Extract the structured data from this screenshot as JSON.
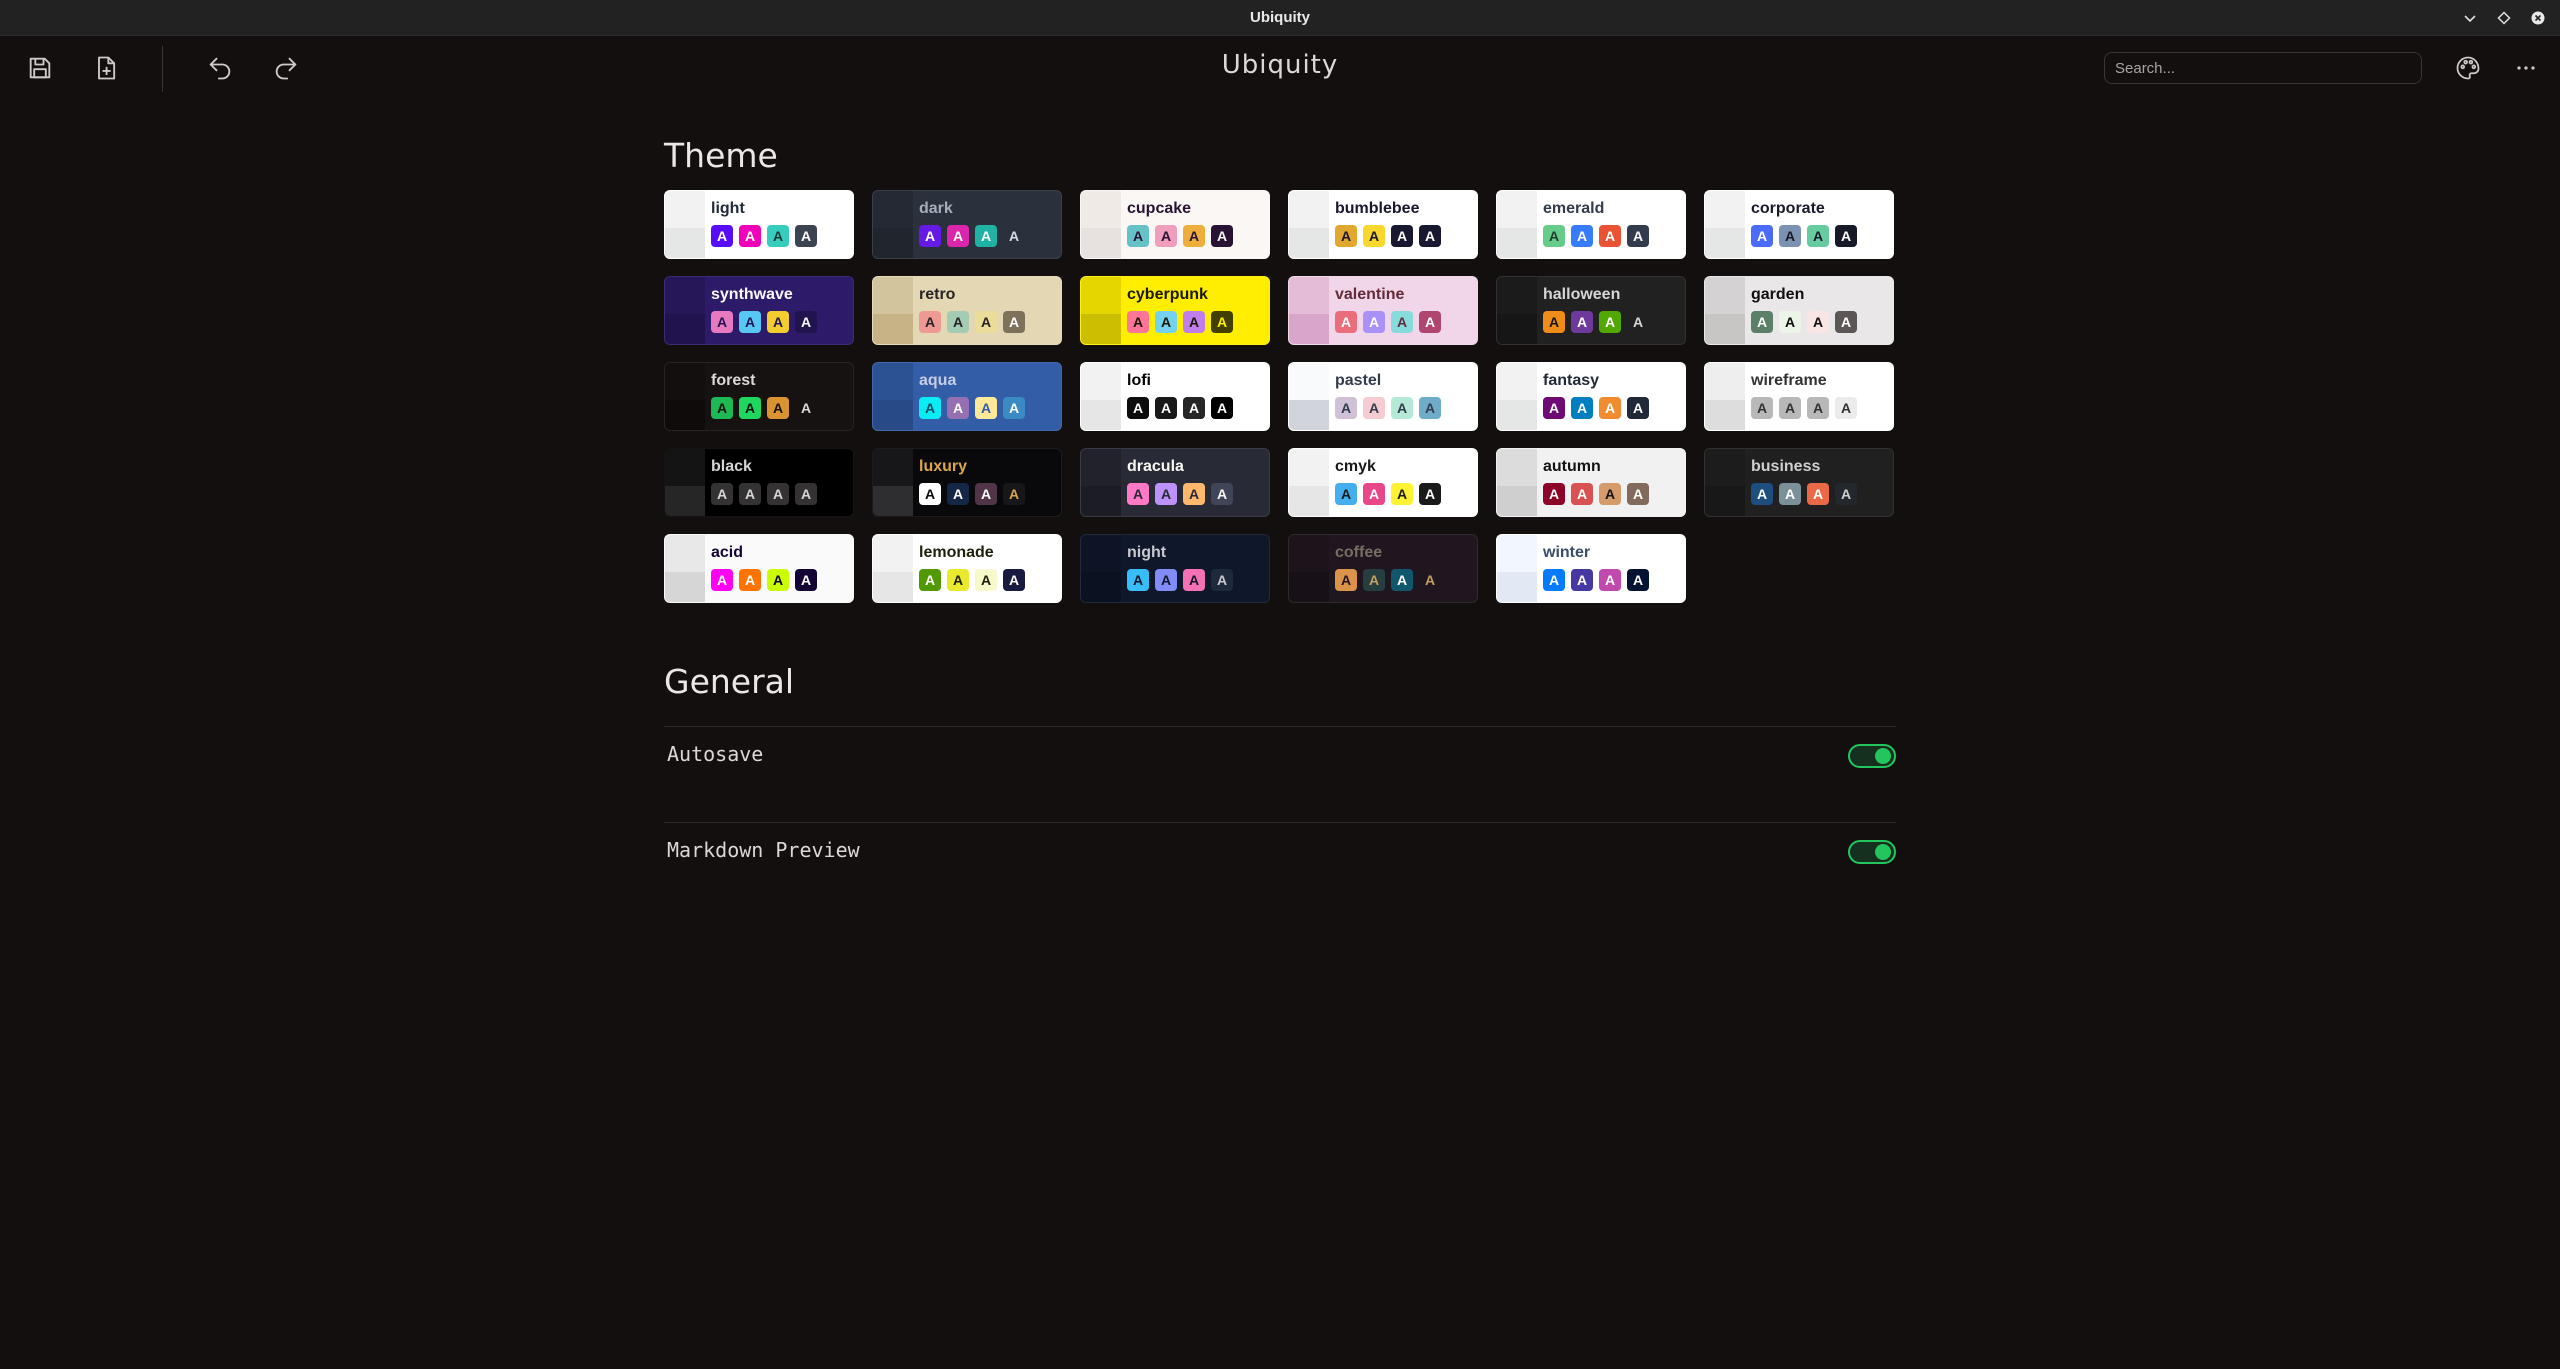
{
  "window": {
    "title": "Ubiquity"
  },
  "toolbar": {
    "app_title": "Ubiquity",
    "search_placeholder": "Search..."
  },
  "sections": {
    "theme": "Theme",
    "general": "General"
  },
  "themes": [
    {
      "name": "light",
      "bg": "#ffffff",
      "fg": "#1f2937",
      "side1": "#f2f2f2",
      "side2": "#e5e6e6",
      "sw": [
        [
          "#570df8",
          "#ffffff"
        ],
        [
          "#f000b8",
          "#ffffff"
        ],
        [
          "#37cdbe",
          "#163835"
        ],
        [
          "#3d4451",
          "#ffffff"
        ]
      ]
    },
    {
      "name": "dark",
      "bg": "#2a303c",
      "fg": "#a6adbb",
      "side1": "#242933",
      "side2": "#20252e",
      "sw": [
        [
          "#661ae6",
          "#ffffff"
        ],
        [
          "#d926aa",
          "#ffffff"
        ],
        [
          "#1fb2a5",
          "#ffffff"
        ],
        [
          "#2a303c",
          "#d7dde4"
        ]
      ]
    },
    {
      "name": "cupcake",
      "bg": "#faf7f5",
      "fg": "#291334",
      "side1": "#efeae6",
      "side2": "#e7e2df",
      "sw": [
        [
          "#65c3c8",
          "#291334"
        ],
        [
          "#ef9fbc",
          "#291334"
        ],
        [
          "#eeaf3a",
          "#291334"
        ],
        [
          "#291334",
          "#faf7f5"
        ]
      ]
    },
    {
      "name": "bumblebee",
      "bg": "#ffffff",
      "fg": "#181830",
      "side1": "#f2f2f2",
      "side2": "#e5e6e6",
      "sw": [
        [
          "#e0a82e",
          "#181830"
        ],
        [
          "#f9d72f",
          "#181830"
        ],
        [
          "#181830",
          "#ffffff"
        ],
        [
          "#181830",
          "#ffffff"
        ]
      ]
    },
    {
      "name": "emerald",
      "bg": "#ffffff",
      "fg": "#333c4d",
      "side1": "#f2f2f2",
      "side2": "#e5e6e6",
      "sw": [
        [
          "#66cc8a",
          "#223d30"
        ],
        [
          "#377cfb",
          "#ffffff"
        ],
        [
          "#ea5234",
          "#ffffff"
        ],
        [
          "#333c4d",
          "#f9fafb"
        ]
      ]
    },
    {
      "name": "corporate",
      "bg": "#ffffff",
      "fg": "#181a2a",
      "side1": "#f2f2f2",
      "side2": "#e5e6e6",
      "sw": [
        [
          "#4b6bfb",
          "#ffffff"
        ],
        [
          "#7b92b2",
          "#181a2a"
        ],
        [
          "#67cba0",
          "#181a2a"
        ],
        [
          "#181a2a",
          "#ffffff"
        ]
      ]
    },
    {
      "name": "synthwave",
      "bg": "#2d1b69",
      "fg": "#f9f7fd",
      "side1": "#251758",
      "side2": "#20134e",
      "sw": [
        [
          "#e779c1",
          "#221551"
        ],
        [
          "#58c7f3",
          "#221551"
        ],
        [
          "#f3cc30",
          "#221551"
        ],
        [
          "#20134e",
          "#f9f7fd"
        ]
      ]
    },
    {
      "name": "retro",
      "bg": "#e4d8b4",
      "fg": "#282425",
      "side1": "#d2c59d",
      "side2": "#c6b386",
      "sw": [
        [
          "#ef9995",
          "#282425"
        ],
        [
          "#a4cbb4",
          "#282425"
        ],
        [
          "#ebdc99",
          "#282425"
        ],
        [
          "#7d7259",
          "#ffffff"
        ]
      ]
    },
    {
      "name": "cyberpunk",
      "bg": "#ffee00",
      "fg": "#1b1a01",
      "side1": "#e6d600",
      "side2": "#ccbe00",
      "sw": [
        [
          "#ff7598",
          "#1b1a01"
        ],
        [
          "#75d1f0",
          "#1b1a01"
        ],
        [
          "#c07eec",
          "#1b1a01"
        ],
        [
          "#423f00",
          "#ffee00"
        ]
      ]
    },
    {
      "name": "valentine",
      "bg": "#f0d6e8",
      "fg": "#632c3b",
      "side1": "#e4bcd8",
      "side2": "#d9a6cb",
      "sw": [
        [
          "#e96d7b",
          "#ffffff"
        ],
        [
          "#a991f7",
          "#ffffff"
        ],
        [
          "#88dbdd",
          "#632c3b"
        ],
        [
          "#af4670",
          "#ffffff"
        ]
      ]
    },
    {
      "name": "halloween",
      "bg": "#212121",
      "fg": "#d6d6d6",
      "side1": "#1b1b1b",
      "side2": "#161616",
      "sw": [
        [
          "#f28c18",
          "#131616"
        ],
        [
          "#6d3a9c",
          "#ffffff"
        ],
        [
          "#51a800",
          "#ffffff"
        ],
        [
          "#212121",
          "#d6d6d6"
        ]
      ]
    },
    {
      "name": "garden",
      "bg": "#e9e7e7",
      "fg": "#100f0f",
      "side1": "#d4d2d2",
      "side2": "#c8c5c5",
      "sw": [
        [
          "#5c7f67",
          "#ffffff"
        ],
        [
          "#ecf4e7",
          "#100f0f"
        ],
        [
          "#fae5e5",
          "#100f0f"
        ],
        [
          "#5d5656",
          "#ffffff"
        ]
      ]
    },
    {
      "name": "forest",
      "bg": "#171212",
      "fg": "#dcd8d8",
      "side1": "#130f0f",
      "side2": "#0f0b0b",
      "sw": [
        [
          "#1eb854",
          "#0b130c"
        ],
        [
          "#1fd65f",
          "#0b130c"
        ],
        [
          "#d99330",
          "#171212"
        ],
        [
          "#171212",
          "#dcd8d8"
        ]
      ]
    },
    {
      "name": "aqua",
      "bg": "#345da7",
      "fg": "#c5cee4",
      "side1": "#2d5294",
      "side2": "#284a87",
      "sw": [
        [
          "#09ecf3",
          "#114b5f"
        ],
        [
          "#966fb3",
          "#ffffff"
        ],
        [
          "#ffe999",
          "#345da7"
        ],
        [
          "#3b8ac4",
          "#ffffff"
        ]
      ]
    },
    {
      "name": "lofi",
      "bg": "#ffffff",
      "fg": "#000000",
      "side1": "#f2f2f2",
      "side2": "#e6e6e6",
      "sw": [
        [
          "#0d0d0d",
          "#ffffff"
        ],
        [
          "#1a1919",
          "#ffffff"
        ],
        [
          "#262626",
          "#ffffff"
        ],
        [
          "#000000",
          "#ffffff"
        ]
      ]
    },
    {
      "name": "pastel",
      "bg": "#ffffff",
      "fg": "#333c4d",
      "side1": "#f9fafb",
      "side2": "#d1d5db",
      "sw": [
        [
          "#d1c1d7",
          "#333c4d"
        ],
        [
          "#f6cbd1",
          "#333c4d"
        ],
        [
          "#b4e9d6",
          "#333c4d"
        ],
        [
          "#70acc7",
          "#333c4d"
        ]
      ]
    },
    {
      "name": "fantasy",
      "bg": "#ffffff",
      "fg": "#1f2937",
      "side1": "#f2f2f2",
      "side2": "#e5e6e6",
      "sw": [
        [
          "#6e0b75",
          "#ffffff"
        ],
        [
          "#007ebd",
          "#ffffff"
        ],
        [
          "#f18c2f",
          "#ffffff"
        ],
        [
          "#1f2937",
          "#ffffff"
        ]
      ]
    },
    {
      "name": "wireframe",
      "bg": "#ffffff",
      "fg": "#333333",
      "side1": "#eeeeee",
      "side2": "#dddddd",
      "sw": [
        [
          "#b8b8b8",
          "#333333"
        ],
        [
          "#b8b8b8",
          "#333333"
        ],
        [
          "#b8b8b8",
          "#333333"
        ],
        [
          "#ebebeb",
          "#333333"
        ]
      ]
    },
    {
      "name": "black",
      "bg": "#000000",
      "fg": "#d6d6d6",
      "side1": "#141414",
      "side2": "#262626",
      "sw": [
        [
          "#343232",
          "#d6d6d6"
        ],
        [
          "#343232",
          "#d6d6d6"
        ],
        [
          "#343232",
          "#d6d6d6"
        ],
        [
          "#343232",
          "#d6d6d6"
        ]
      ]
    },
    {
      "name": "luxury",
      "bg": "#09090b",
      "fg": "#dca54c",
      "side1": "#171618",
      "side2": "#2e2d2f",
      "sw": [
        [
          "#ffffff",
          "#09090b"
        ],
        [
          "#152747",
          "#ffffff"
        ],
        [
          "#513448",
          "#ffffff"
        ],
        [
          "#171618",
          "#dca54c"
        ]
      ]
    },
    {
      "name": "dracula",
      "bg": "#282a36",
      "fg": "#f8f8f2",
      "side1": "#21222c",
      "side2": "#1c1d24",
      "sw": [
        [
          "#ff79c6",
          "#282a36"
        ],
        [
          "#bd93f9",
          "#282a36"
        ],
        [
          "#ffb86c",
          "#282a36"
        ],
        [
          "#414558",
          "#f8f8f2"
        ]
      ]
    },
    {
      "name": "cmyk",
      "bg": "#ffffff",
      "fg": "#1a1a1a",
      "side1": "#f2f2f2",
      "side2": "#e6e6e6",
      "sw": [
        [
          "#45aeee",
          "#1a1a1a"
        ],
        [
          "#e8488a",
          "#ffffff"
        ],
        [
          "#fff232",
          "#1a1a1a"
        ],
        [
          "#1a1a1a",
          "#ffffff"
        ]
      ]
    },
    {
      "name": "autumn",
      "bg": "#f1f1f1",
      "fg": "#141414",
      "side1": "#dcdcdc",
      "side2": "#cfcfcf",
      "sw": [
        [
          "#8c0327",
          "#ffffff"
        ],
        [
          "#d85251",
          "#ffffff"
        ],
        [
          "#d59b6a",
          "#141414"
        ],
        [
          "#826a5c",
          "#ffffff"
        ]
      ]
    },
    {
      "name": "business",
      "bg": "#202020",
      "fg": "#cfcfcf",
      "side1": "#1c1c1c",
      "side2": "#181818",
      "sw": [
        [
          "#1c4e80",
          "#ffffff"
        ],
        [
          "#7c909a",
          "#ffffff"
        ],
        [
          "#ea6947",
          "#ffffff"
        ],
        [
          "#23282e",
          "#cfcfcf"
        ]
      ]
    },
    {
      "name": "acid",
      "bg": "#fafafa",
      "fg": "#140436",
      "side1": "#e8e8e8",
      "side2": "#d6d6d6",
      "sw": [
        [
          "#ff00f4",
          "#ffffff"
        ],
        [
          "#ff7400",
          "#ffffff"
        ],
        [
          "#cbfd03",
          "#140436"
        ],
        [
          "#140436",
          "#ffffff"
        ]
      ]
    },
    {
      "name": "lemonade",
      "bg": "#ffffff",
      "fg": "#1d2008",
      "side1": "#f2f2f2",
      "side2": "#e6e6e6",
      "sw": [
        [
          "#519903",
          "#ffffff"
        ],
        [
          "#e9e92e",
          "#1d2008"
        ],
        [
          "#f7f9ca",
          "#1d2008"
        ],
        [
          "#191a3f",
          "#ffffff"
        ]
      ]
    },
    {
      "name": "night",
      "bg": "#0f172a",
      "fg": "#c8cad0",
      "side1": "#0c1425",
      "side2": "#0a1120",
      "sw": [
        [
          "#38bdf8",
          "#0f172a"
        ],
        [
          "#818cf8",
          "#0f172a"
        ],
        [
          "#f471b5",
          "#0f172a"
        ],
        [
          "#1e293b",
          "#c8cad0"
        ]
      ]
    },
    {
      "name": "coffee",
      "bg": "#20161f",
      "fg": "#756e63",
      "side1": "#1c131b",
      "side2": "#181017",
      "sw": [
        [
          "#db924b",
          "#20161f"
        ],
        [
          "#263e3f",
          "#c59f60"
        ],
        [
          "#10576d",
          "#ffffff"
        ],
        [
          "#20161f",
          "#c59f60"
        ]
      ]
    },
    {
      "name": "winter",
      "bg": "#ffffff",
      "fg": "#394e6a",
      "side1": "#f2f7ff",
      "side2": "#e3e9f4",
      "sw": [
        [
          "#047aff",
          "#ffffff"
        ],
        [
          "#463aa2",
          "#ffffff"
        ],
        [
          "#c148ac",
          "#ffffff"
        ],
        [
          "#021431",
          "#ffffff"
        ]
      ]
    }
  ],
  "settings": [
    {
      "label": "Autosave",
      "enabled": true
    },
    {
      "label": "Markdown Preview",
      "enabled": true
    }
  ],
  "colors": {
    "background": "#130f0f",
    "accent": "#22c55e"
  },
  "swatch_letter": "A"
}
